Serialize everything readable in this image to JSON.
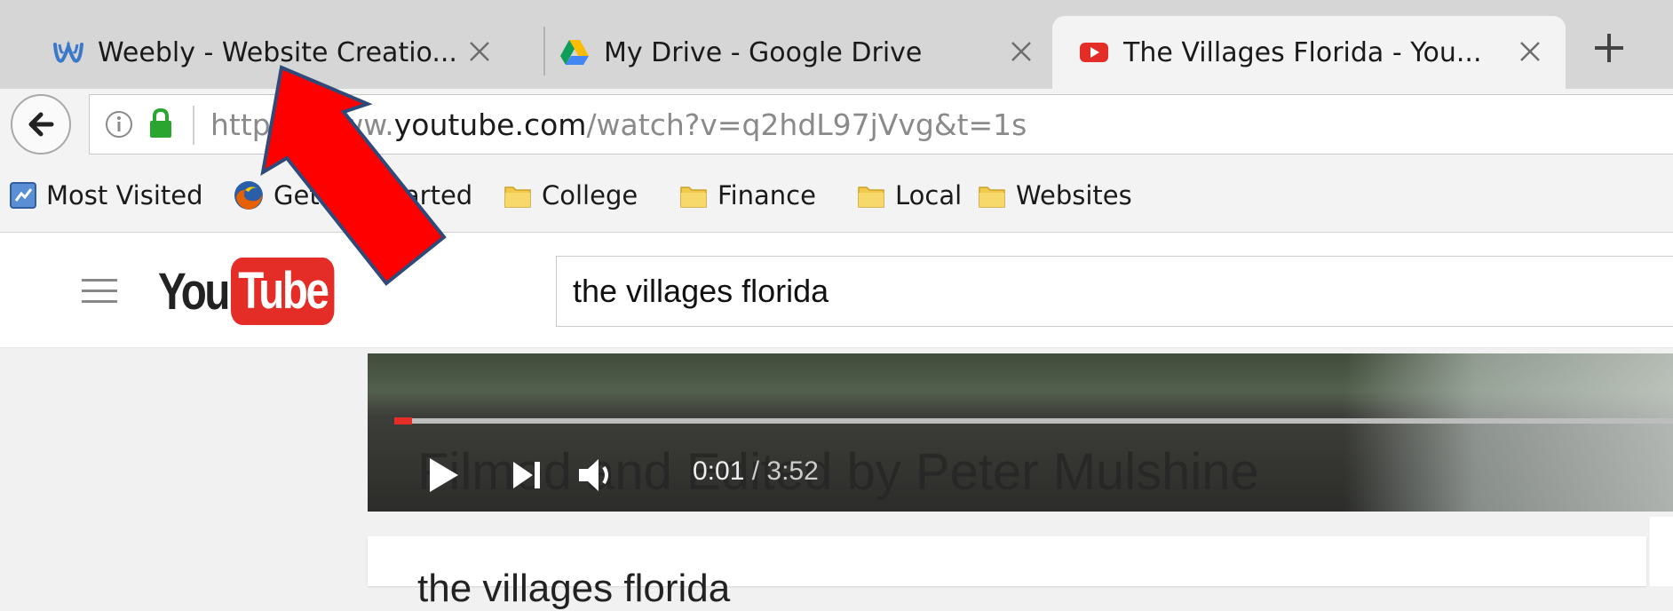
{
  "tabs": [
    {
      "title": "Weebly - Website Creatio...",
      "favicon": "weebly-icon",
      "active": false
    },
    {
      "title": "My Drive - Google Drive",
      "favicon": "google-drive-icon",
      "active": false
    },
    {
      "title": "The Villages Florida - You...",
      "favicon": "youtube-icon",
      "active": true
    }
  ],
  "address_bar": {
    "scheme": "https://www.",
    "host": "youtube.com",
    "path": "/watch?v=q2hdL97jVvg&t=1s"
  },
  "bookmarks": [
    {
      "label": "Most Visited",
      "icon": "most-visited-icon"
    },
    {
      "label": "Getting Started",
      "icon": "firefox-icon"
    },
    {
      "label": "College",
      "icon": "folder-icon"
    },
    {
      "label": "Finance",
      "icon": "folder-icon"
    },
    {
      "label": "Local",
      "icon": "folder-icon"
    },
    {
      "label": "Websites",
      "icon": "folder-icon"
    }
  ],
  "youtube": {
    "logo_you": "You",
    "logo_tube": "Tube",
    "search_query": "the villages florida"
  },
  "player": {
    "subtitle": "Filmed and Edited by Peter Mulshine",
    "current_time": "0:01",
    "duration": "3:52",
    "progress_fraction": 0.004
  },
  "video_title": "the villages florida",
  "colors": {
    "youtube_red": "#e52d27",
    "annotation_arrow": "#ff0000"
  }
}
